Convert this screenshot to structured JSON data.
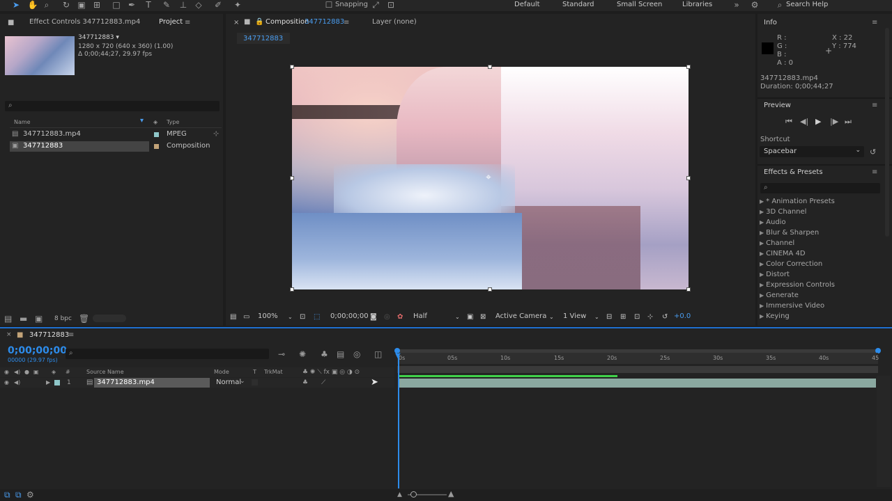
{
  "toolbar": {
    "snapping_label": "Snapping",
    "workspaces": [
      "Default",
      "Standard",
      "Small Screen",
      "Libraries"
    ],
    "search_help_label": "Search Help"
  },
  "project_panel": {
    "tabs": [
      "Effect Controls 347712883.mp4",
      "Project"
    ],
    "selected_item_name": "347712883 ▾",
    "selected_item_dims": "1280 x 720  (640 x 360) (1.00)",
    "selected_item_duration": "Δ 0;00;44;27, 29.97 fps",
    "columns": [
      "Name",
      "Type"
    ],
    "items": [
      {
        "name": "347712883.mp4",
        "type": "MPEG",
        "color": "#8fc7c9"
      },
      {
        "name": "347712883",
        "type": "Composition",
        "color": "#c2a378"
      }
    ],
    "bpc_label": "8 bpc"
  },
  "composition_panel": {
    "tab_label": "Composition",
    "tab_name": "347712883",
    "layer_tab": "Layer (none)",
    "breadcrumb": "347712883",
    "zoom": "100%",
    "timecode": "0;00;00;00",
    "resolution": "Half",
    "camera": "Active Camera",
    "view": "1 View",
    "exposure": "+0.0"
  },
  "info_panel": {
    "title": "Info",
    "r": "R :",
    "g": "G :",
    "b": "B :",
    "a": "A :  0",
    "x": "X : 22",
    "y": "Y : 774",
    "file": "347712883.mp4",
    "duration": "Duration: 0;00;44;27"
  },
  "preview_panel": {
    "title": "Preview",
    "shortcut_label": "Shortcut",
    "shortcut_value": "Spacebar"
  },
  "effects_panel": {
    "title": "Effects & Presets",
    "items": [
      "* Animation Presets",
      "3D Channel",
      "Audio",
      "Blur & Sharpen",
      "Channel",
      "CINEMA 4D",
      "Color Correction",
      "Distort",
      "Expression Controls",
      "Generate",
      "Immersive Video",
      "Keying"
    ]
  },
  "timeline": {
    "tab_name": "347712883",
    "timecode": "0;00;00;00",
    "frames": "00000 (29.97 fps)",
    "columns": [
      "Source Name",
      "Mode",
      "T",
      "TrkMat"
    ],
    "layer": {
      "index": "1",
      "name": "347712883.mp4",
      "mode": "Normal"
    },
    "ruler_ticks": [
      "0s",
      "05s",
      "10s",
      "15s",
      "20s",
      "25s",
      "30s",
      "35s",
      "40s",
      "45"
    ]
  },
  "colors": {
    "accent": "#2d8ceb",
    "timeline_border": "#1e6fce",
    "render_bar": "#3fd14a",
    "layer_bar": "#8aa8a0"
  }
}
